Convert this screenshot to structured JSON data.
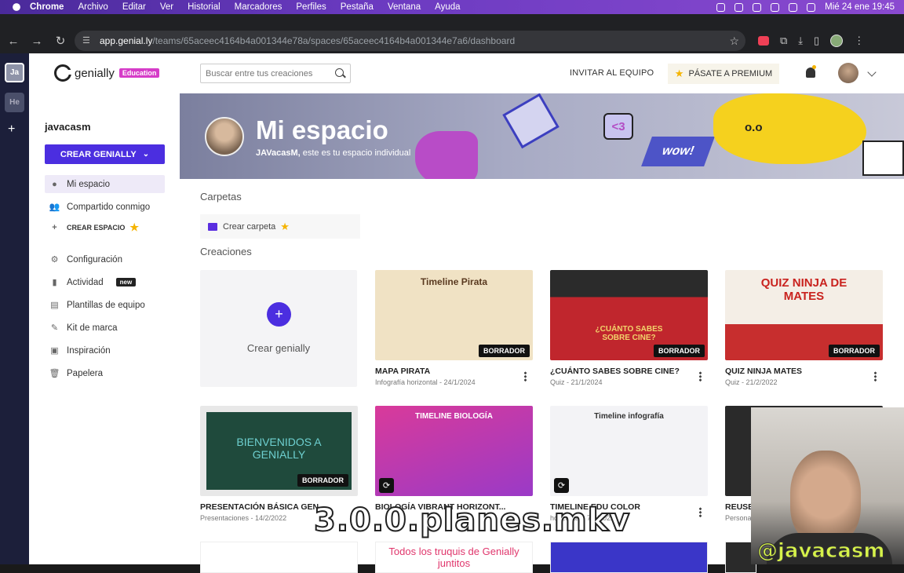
{
  "mac_menu": {
    "app": "Chrome",
    "items": [
      "Archivo",
      "Editar",
      "Ver",
      "Historial",
      "Marcadores",
      "Perfiles",
      "Pestaña",
      "Ventana",
      "Ayuda"
    ],
    "clock": "Mié 24 ene  19:45"
  },
  "browser": {
    "url_host": "app.genial.ly",
    "url_path": "/teams/65aceec4164b4a001344e78a/spaces/65aceec4164b4a001344e7a6/dashboard"
  },
  "teams": [
    {
      "label": "Ja",
      "active": true
    },
    {
      "label": "He",
      "active": false
    }
  ],
  "sidebar": {
    "logo_word": "genially",
    "logo_badge": "Education",
    "username": "javacasm",
    "create_button": "CREAR GENIALLY",
    "items": [
      {
        "label": "Mi espacio",
        "icon": "user-icon"
      },
      {
        "label": "Compartido conmigo",
        "icon": "people-icon"
      },
      {
        "label": "CREAR ESPACIO",
        "icon": "plus-icon"
      },
      {
        "label": "Configuración",
        "icon": "gear-icon"
      },
      {
        "label": "Actividad",
        "icon": "bar-chart-icon",
        "badge": "new"
      },
      {
        "label": "Plantillas de equipo",
        "icon": "template-icon"
      },
      {
        "label": "Kit de marca",
        "icon": "brand-kit-icon"
      },
      {
        "label": "Inspiración",
        "icon": "inspiration-icon"
      },
      {
        "label": "Papelera",
        "icon": "trash-icon"
      }
    ]
  },
  "topbar": {
    "search_placeholder": "Buscar entre tus creaciones",
    "invite": "INVITAR AL EQUIPO",
    "premium": "PÁSATE A PREMIUM"
  },
  "hero": {
    "title": "Mi espacio",
    "subtitle_name": "JAVacasM,",
    "subtitle_rest": " este es tu espacio individual",
    "deco_heart": "<3",
    "deco_wow": "wow!",
    "deco_face": "o.o"
  },
  "sections": {
    "folders": "Carpetas",
    "create_folder": "Crear carpeta",
    "creations": "Creaciones",
    "create_genially": "Crear genially"
  },
  "cards": [
    {
      "title": "MAPA PIRATA",
      "sub": "Infografía horizontal - 24/1/2024",
      "thumb_text": "Timeline Pirata",
      "draft": "BORRADOR",
      "bg": "#f0e2c4"
    },
    {
      "title": "¿CUÁNTO SABES SOBRE CINE?",
      "sub": "Quiz - 21/1/2024",
      "thumb_text": "¿CUÁNTO SABES SOBRE CINE?",
      "draft": "BORRADOR",
      "bg": "#c0262d"
    },
    {
      "title": "QUIZ NINJA MATES",
      "sub": "Quiz - 21/2/2022",
      "thumb_text": "QUIZ NINJA DE MATES",
      "draft": "BORRADOR",
      "bg": "#f4eee6"
    },
    {
      "title": "PRESENTACIÓN BÁSICA GEN...",
      "sub": "Presentaciones - 14/2/2022",
      "thumb_text": "BIENVENIDOS A GENIALLY",
      "draft": "BORRADOR",
      "bg": "#1f4a3c"
    },
    {
      "title": "BIOLOGÍA VIBRANT HORIZONT...",
      "sub": "",
      "thumb_text": "TIMELINE BIOLOGÍA",
      "draft": "",
      "bg": "#d93a9a"
    },
    {
      "title": "TIMELINE EDU COLOR",
      "sub": "horizontal - 7/2/2022",
      "thumb_text": "Timeline infografía",
      "draft": "",
      "bg": "#f3f3f6"
    },
    {
      "title": "REUSE",
      "sub": "Persona",
      "thumb_text": "",
      "draft": "",
      "bg": "#2a2a2a"
    }
  ],
  "bottom_row_text": "Todos los truquis de Genially juntitos",
  "overlay_text": "3.0.0.planes.mkv",
  "webcam_handle": "@javacasm",
  "colors": {
    "brand": "#4b2ee0",
    "badge": "#d63cc8",
    "premium_star": "#f5b400"
  }
}
